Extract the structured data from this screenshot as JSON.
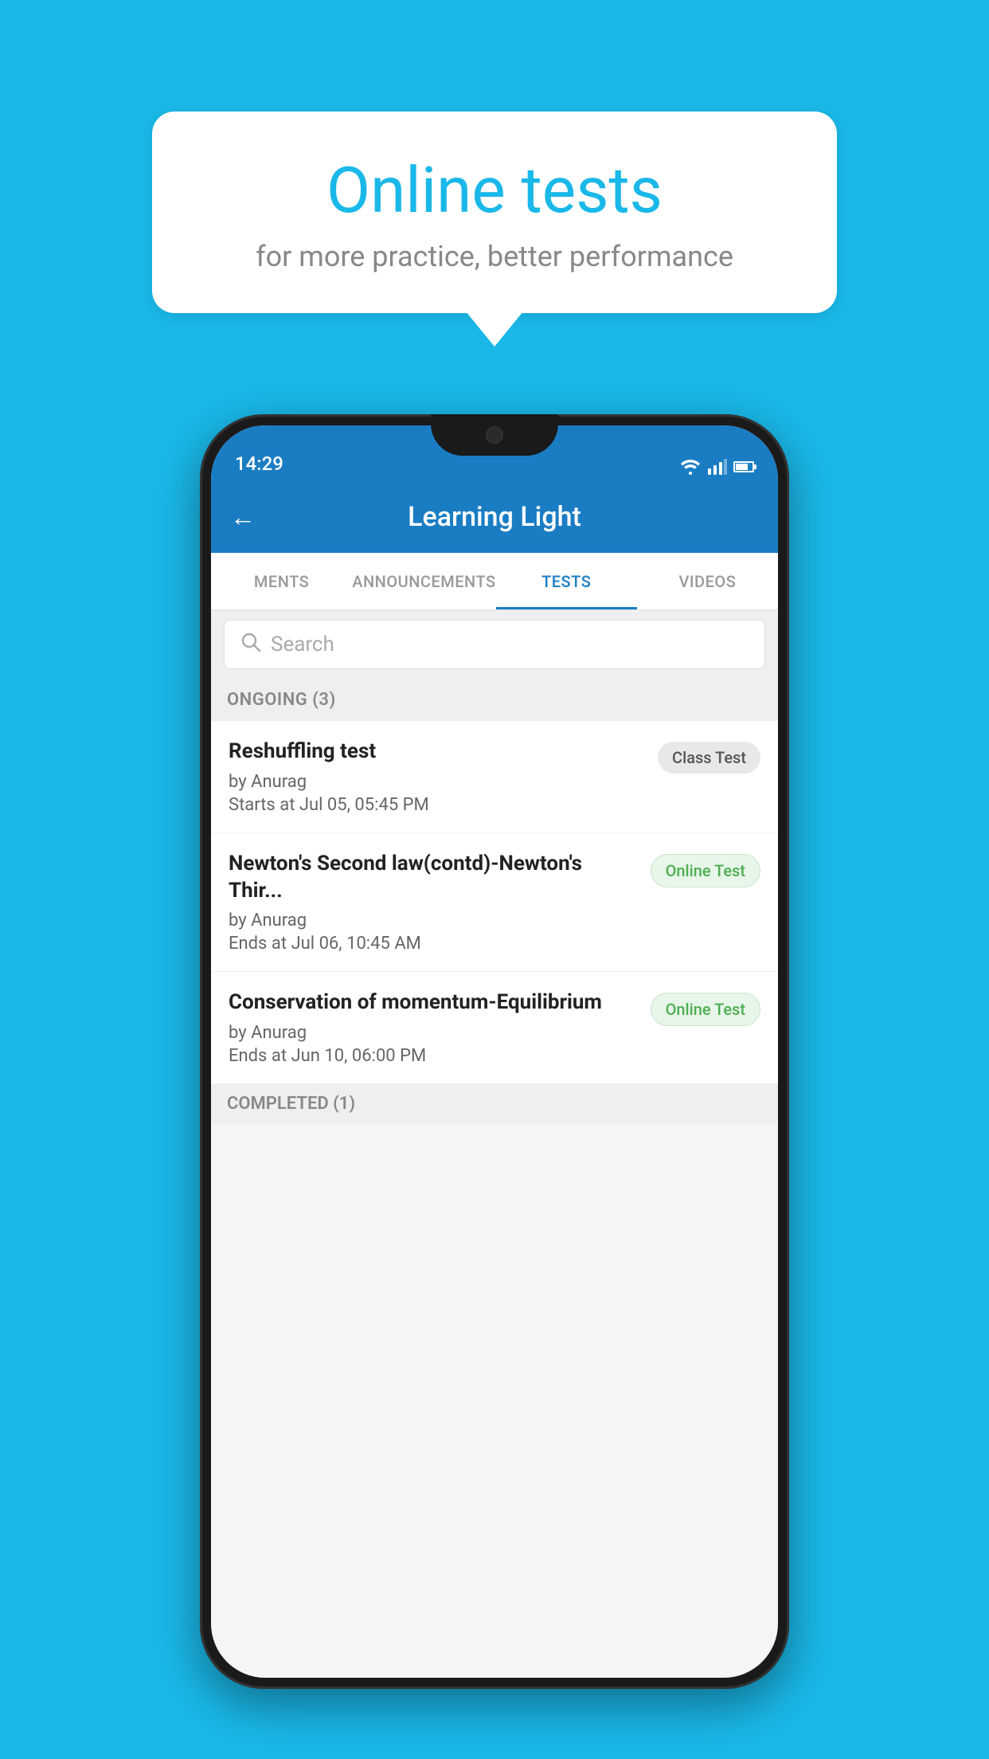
{
  "background_color": "#1ab8e8",
  "speech_bubble": {
    "title": "Online tests",
    "subtitle": "for more practice, better performance"
  },
  "status_bar": {
    "time": "14:29"
  },
  "app_header": {
    "title": "Learning Light",
    "back_label": "←"
  },
  "tabs": [
    {
      "label": "MENTS",
      "active": false
    },
    {
      "label": "ANNOUNCEMENTS",
      "active": false
    },
    {
      "label": "TESTS",
      "active": true
    },
    {
      "label": "VIDEOS",
      "active": false
    }
  ],
  "search": {
    "placeholder": "Search"
  },
  "ongoing_section": {
    "title": "ONGOING (3)",
    "items": [
      {
        "name": "Reshuffling test",
        "author": "by Anurag",
        "date": "Starts at  Jul 05, 05:45 PM",
        "badge": "Class Test",
        "badge_type": "class"
      },
      {
        "name": "Newton's Second law(contd)-Newton's Thir...",
        "author": "by Anurag",
        "date": "Ends at  Jul 06, 10:45 AM",
        "badge": "Online Test",
        "badge_type": "online"
      },
      {
        "name": "Conservation of momentum-Equilibrium",
        "author": "by Anurag",
        "date": "Ends at  Jun 10, 06:00 PM",
        "badge": "Online Test",
        "badge_type": "online"
      }
    ]
  },
  "completed_section": {
    "title": "COMPLETED (1)"
  }
}
